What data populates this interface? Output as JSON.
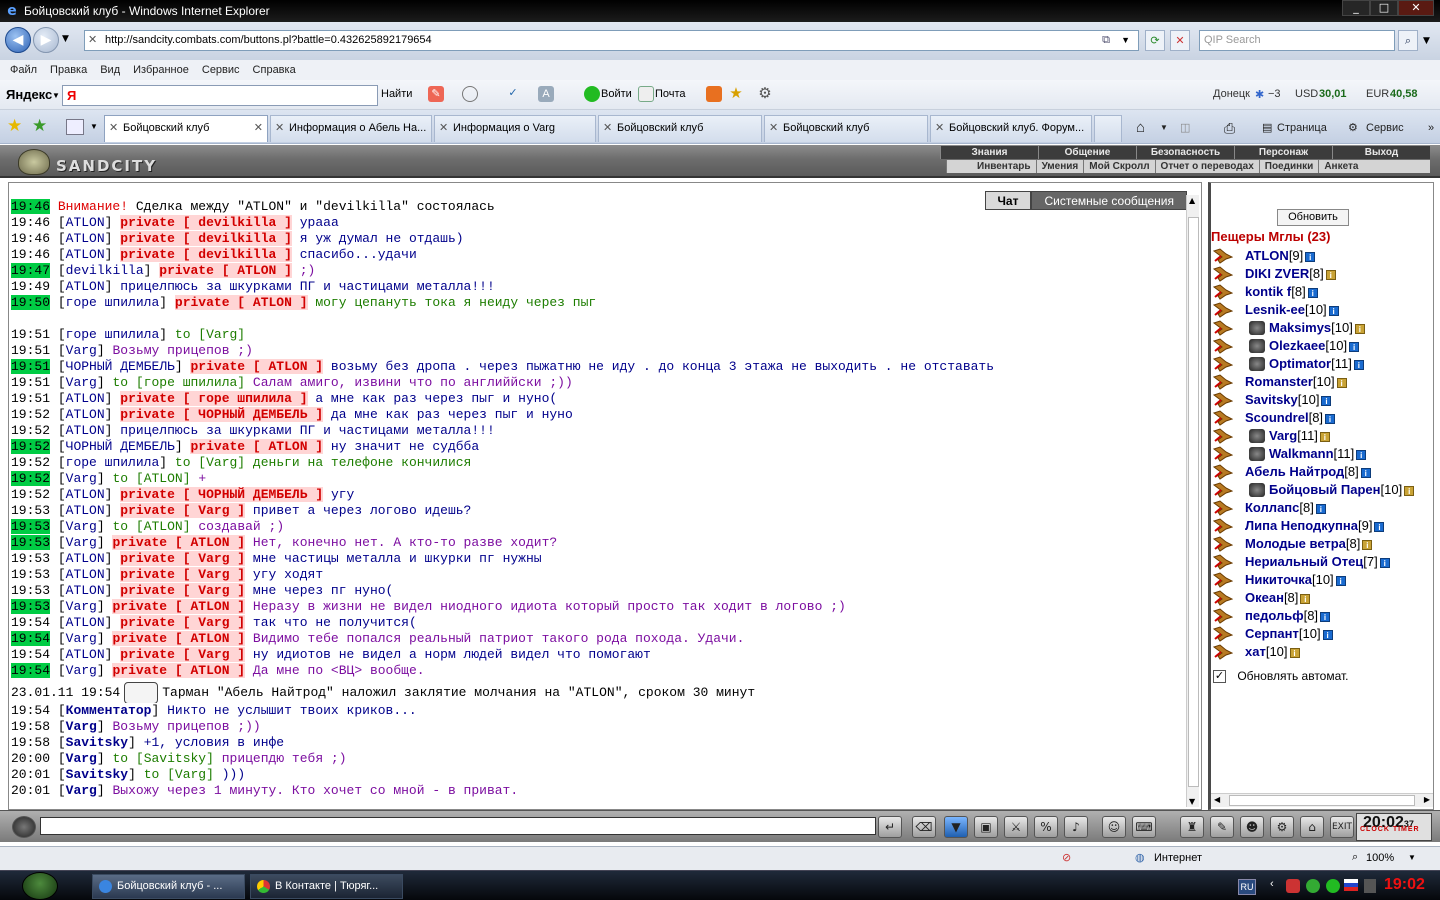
{
  "window": {
    "title": "Бойцовский клуб - Windows Internet Explorer",
    "min": "_",
    "max": "□",
    "close": "✕"
  },
  "browser": {
    "url": "http://sandcity.combats.com/buttons.pl?battle=0.432625892179654",
    "qip_placeholder": "QIP Search",
    "menu": [
      "Файл",
      "Правка",
      "Вид",
      "Избранное",
      "Сервис",
      "Справка"
    ]
  },
  "yandex": {
    "logo": "Яндекс",
    "input_value": "Я",
    "find": "Найти",
    "login": "Войти",
    "mail": "Почта",
    "city": "Донецк",
    "temp": "−3",
    "usd_label": "USD",
    "usd": "30,01",
    "eur_label": "EUR",
    "eur": "40,58"
  },
  "tabs": [
    {
      "label": "Бойцовский клуб",
      "active": true
    },
    {
      "label": "Информация о Абель На...",
      "active": false
    },
    {
      "label": "Информация о Varg",
      "active": false
    },
    {
      "label": "Бойцовский клуб",
      "active": false
    },
    {
      "label": "Бойцовский клуб",
      "active": false
    },
    {
      "label": "Бойцовский клуб. Форум...",
      "active": false
    }
  ],
  "commands": {
    "page": "Страница",
    "tools": "Сервис"
  },
  "game": {
    "logo": "SANDCITY",
    "menu_top": [
      "Знания",
      "Общение",
      "Безопасность",
      "Персонаж",
      "Выход"
    ],
    "menu_bottom": [
      "Инвентарь",
      "Умения",
      "Мой Скролл",
      "Отчет о переводах",
      "Поединки",
      "Анкета"
    ]
  },
  "chat": {
    "tabs": [
      "Чат",
      "Системные сообщения"
    ],
    "lines": [
      {
        "time": "19:46",
        "hl": true,
        "nick": "",
        "priv": "",
        "text": "Сделка между \"ATLON\" и \"devilkilla\" состоялась",
        "sys": "Внимание!",
        "kind": "sys"
      },
      {
        "time": "19:46",
        "hl": false,
        "nick": "ATLON",
        "priv": "private [ devilkilla ]",
        "text": "урааа",
        "kind": "pm"
      },
      {
        "time": "19:46",
        "hl": false,
        "nick": "ATLON",
        "priv": "private [ devilkilla ]",
        "text": "я уж думал не отдашь)",
        "kind": "pm"
      },
      {
        "time": "19:46",
        "hl": false,
        "nick": "ATLON",
        "priv": "private [ devilkilla ]",
        "text": "спасибо...удачи",
        "kind": "pm"
      },
      {
        "time": "19:47",
        "hl": true,
        "nick": "devilkilla",
        "priv": "private [ ATLON ]",
        "text": ";)",
        "kind": "vio"
      },
      {
        "time": "19:49",
        "hl": false,
        "nick": "ATLON",
        "priv": "",
        "text": "прицелпюсь за шкурками ПГ и частицами металла!!!",
        "kind": "plain"
      },
      {
        "time": "19:50",
        "hl": true,
        "nick": "горе шпилила",
        "priv": "private [ ATLON ]",
        "text": "могу цепануть тока я неиду через пыг",
        "kind": "grn"
      },
      {
        "time": "",
        "hl": false,
        "nick": "",
        "priv": "",
        "text": "",
        "kind": "blank"
      },
      {
        "time": "19:51",
        "hl": false,
        "nick": "горе шпилила",
        "priv": "",
        "to": "to [Varg]",
        "text": "",
        "kind": "grn"
      },
      {
        "time": "19:51",
        "hl": false,
        "nick": "Varg",
        "priv": "",
        "text": "Возьму прицепов ;)",
        "kind": "vio"
      },
      {
        "time": "19:51",
        "hl": true,
        "nick": "ЧОРНЫЙ ДЕМБЕЛЬ",
        "priv": "private [ ATLON ]",
        "text": "возьму без дропа . через пыжатню не иду . до конца 3 этажа не выходить . не отставать",
        "kind": "pm"
      },
      {
        "time": "19:51",
        "hl": false,
        "nick": "Varg",
        "priv": "",
        "to": "to [горе шпилила]",
        "text": "Салам амиго, извини что по английйски ;))",
        "kind": "vio"
      },
      {
        "time": "19:51",
        "hl": false,
        "nick": "ATLON",
        "priv": "private [ горе шпилила ]",
        "text": "а мне как раз через пыг и нуно(",
        "kind": "pm"
      },
      {
        "time": "19:52",
        "hl": false,
        "nick": "ATLON",
        "priv": "private [ ЧОРНЫЙ ДЕМБЕЛЬ ]",
        "text": "да мне как раз через пыг и нуно",
        "kind": "pm"
      },
      {
        "time": "19:52",
        "hl": false,
        "nick": "ATLON",
        "priv": "",
        "text": "прицелпюсь за шкурками ПГ и частицами металла!!!",
        "kind": "plain"
      },
      {
        "time": "19:52",
        "hl": true,
        "nick": "ЧОРНЫЙ ДЕМБЕЛЬ",
        "priv": "private [ ATLON ]",
        "text": "ну значит не судбба",
        "kind": "pm"
      },
      {
        "time": "19:52",
        "hl": false,
        "nick": "горе шпилила",
        "priv": "",
        "to": "to [Varg]",
        "text": "деньги на телефоне кончилися",
        "kind": "grn"
      },
      {
        "time": "19:52",
        "hl": true,
        "nick": "Varg",
        "priv": "",
        "to": "to [ATLON]",
        "text": "+",
        "kind": "vio"
      },
      {
        "time": "19:52",
        "hl": false,
        "nick": "ATLON",
        "priv": "private [ ЧОРНЫЙ ДЕМБЕЛЬ ]",
        "text": "угу",
        "kind": "pm"
      },
      {
        "time": "19:53",
        "hl": false,
        "nick": "ATLON",
        "priv": "private [ Varg ]",
        "text": "привет а через логово идешь?",
        "kind": "pm"
      },
      {
        "time": "19:53",
        "hl": true,
        "nick": "Varg",
        "priv": "",
        "to": "to [ATLON]",
        "text": "создавай ;)",
        "kind": "vio"
      },
      {
        "time": "19:53",
        "hl": true,
        "nick": "Varg",
        "priv": "private [ ATLON ]",
        "text": "Нет, конечно нет. А кто-то разве ходит?",
        "kind": "vio"
      },
      {
        "time": "19:53",
        "hl": false,
        "nick": "ATLON",
        "priv": "private [ Varg ]",
        "text": "мне частицы металла и шкурки пг нужны",
        "kind": "pm"
      },
      {
        "time": "19:53",
        "hl": false,
        "nick": "ATLON",
        "priv": "private [ Varg ]",
        "text": "угу ходят",
        "kind": "pm"
      },
      {
        "time": "19:53",
        "hl": false,
        "nick": "ATLON",
        "priv": "private [ Varg ]",
        "text": "мне через пг нуно(",
        "kind": "pm"
      },
      {
        "time": "19:53",
        "hl": true,
        "nick": "Varg",
        "priv": "private [ ATLON ]",
        "text": "Неразу в жизни не видел ниодного идиота который просто так ходит в логово ;)",
        "kind": "vio"
      },
      {
        "time": "19:54",
        "hl": false,
        "nick": "ATLON",
        "priv": "private [ Varg ]",
        "text": "так что не получится(",
        "kind": "pm"
      },
      {
        "time": "19:54",
        "hl": true,
        "nick": "Varg",
        "priv": "private [ ATLON ]",
        "text": "Видимо тебе попался реальный патриот такого рода похода. Удачи.",
        "kind": "vio"
      },
      {
        "time": "19:54",
        "hl": false,
        "nick": "ATLON",
        "priv": "private [ Varg ]",
        "text": "ну идиотов не видел а норм людей видел что помогают",
        "kind": "pm"
      },
      {
        "time": "19:54",
        "hl": true,
        "nick": "Varg",
        "priv": "private [ ATLON ]",
        "text": "Да мне по <ВЦ> вообще.",
        "kind": "vio"
      }
    ],
    "spell_time": "23.01.11 19:54",
    "spell_text": "Тарман \"Абель Найтрод\" наложил заклятие молчания на \"ATLON\", сроком 30 минут",
    "tail": [
      {
        "time": "19:54",
        "nick": "Комментатор",
        "to": "",
        "text": "Никто не услышит твоих криков...",
        "kind": "plain"
      },
      {
        "time": "19:58",
        "nick": "Varg",
        "to": "",
        "text": "Возьму прицепов ;))",
        "kind": "vio"
      },
      {
        "time": "19:58",
        "nick": "Savitsky",
        "to": "",
        "text": "+1, условия в инфе",
        "kind": "plain"
      },
      {
        "time": "20:00",
        "nick": "Varg",
        "to": "to [Savitsky]",
        "text": "прицепдю тебя ;)",
        "kind": "vio"
      },
      {
        "time": "20:01",
        "nick": "Savitsky",
        "to": "to [Varg]",
        "text": ")))",
        "kind": "plain"
      },
      {
        "time": "20:01",
        "nick": "Varg",
        "to": "",
        "text": "Выхожу через 1 минуту. Кто хочет со мной - в приват.",
        "kind": "vio"
      }
    ]
  },
  "room": {
    "refresh": "Обновить",
    "title": "Пещеры Мглы (23)",
    "users": [
      {
        "name": "ATLON",
        "level": "[9]",
        "indent": false
      },
      {
        "name": "DIKI ZVER",
        "level": "[8]",
        "indent": false
      },
      {
        "name": "kontik f",
        "level": "[8]",
        "indent": false
      },
      {
        "name": "Lesnik-ee",
        "level": "[10]",
        "indent": false
      },
      {
        "name": "Maksimys",
        "level": "[10]",
        "indent": true
      },
      {
        "name": "Olezkaee",
        "level": "[10]",
        "indent": true
      },
      {
        "name": "Optimator",
        "level": "[11]",
        "indent": true
      },
      {
        "name": "Romanster",
        "level": "[10]",
        "indent": false
      },
      {
        "name": "Savitsky",
        "level": "[10]",
        "indent": false
      },
      {
        "name": "Scoundrel",
        "level": "[8]",
        "indent": false
      },
      {
        "name": "Varg",
        "level": "[11]",
        "indent": true
      },
      {
        "name": "Walkmann",
        "level": "[11]",
        "indent": true
      },
      {
        "name": "Абель Найтрод",
        "level": "[8]",
        "indent": false
      },
      {
        "name": "Бойцовый Парен",
        "level": "[10]",
        "indent": true
      },
      {
        "name": "Коллапс",
        "level": "[8]",
        "indent": false
      },
      {
        "name": "Липа Неподкупна",
        "level": "[9]",
        "indent": false
      },
      {
        "name": "Молодые ветра",
        "level": "[8]",
        "indent": false
      },
      {
        "name": "Нериальный Отец",
        "level": "[7]",
        "indent": false
      },
      {
        "name": "Никиточка",
        "level": "[10]",
        "indent": false
      },
      {
        "name": "Океан",
        "level": "[8]",
        "indent": false
      },
      {
        "name": "педольф",
        "level": "[8]",
        "indent": false
      },
      {
        "name": "Серпант",
        "level": "[10]",
        "indent": false
      },
      {
        "name": "хат",
        "level": "[10]",
        "indent": false
      }
    ],
    "auto_refresh": "Обновлять автомат."
  },
  "clock": {
    "time": "20:02",
    "sec": "37",
    "label": "CLOCK TIMER"
  },
  "status": {
    "zone": "Интернет",
    "zoom": "100%"
  },
  "taskbar": {
    "items": [
      "Бойцовский клуб - ...",
      "В Контакте | Тюряг..."
    ],
    "lang": "RU",
    "time": "19:02"
  }
}
